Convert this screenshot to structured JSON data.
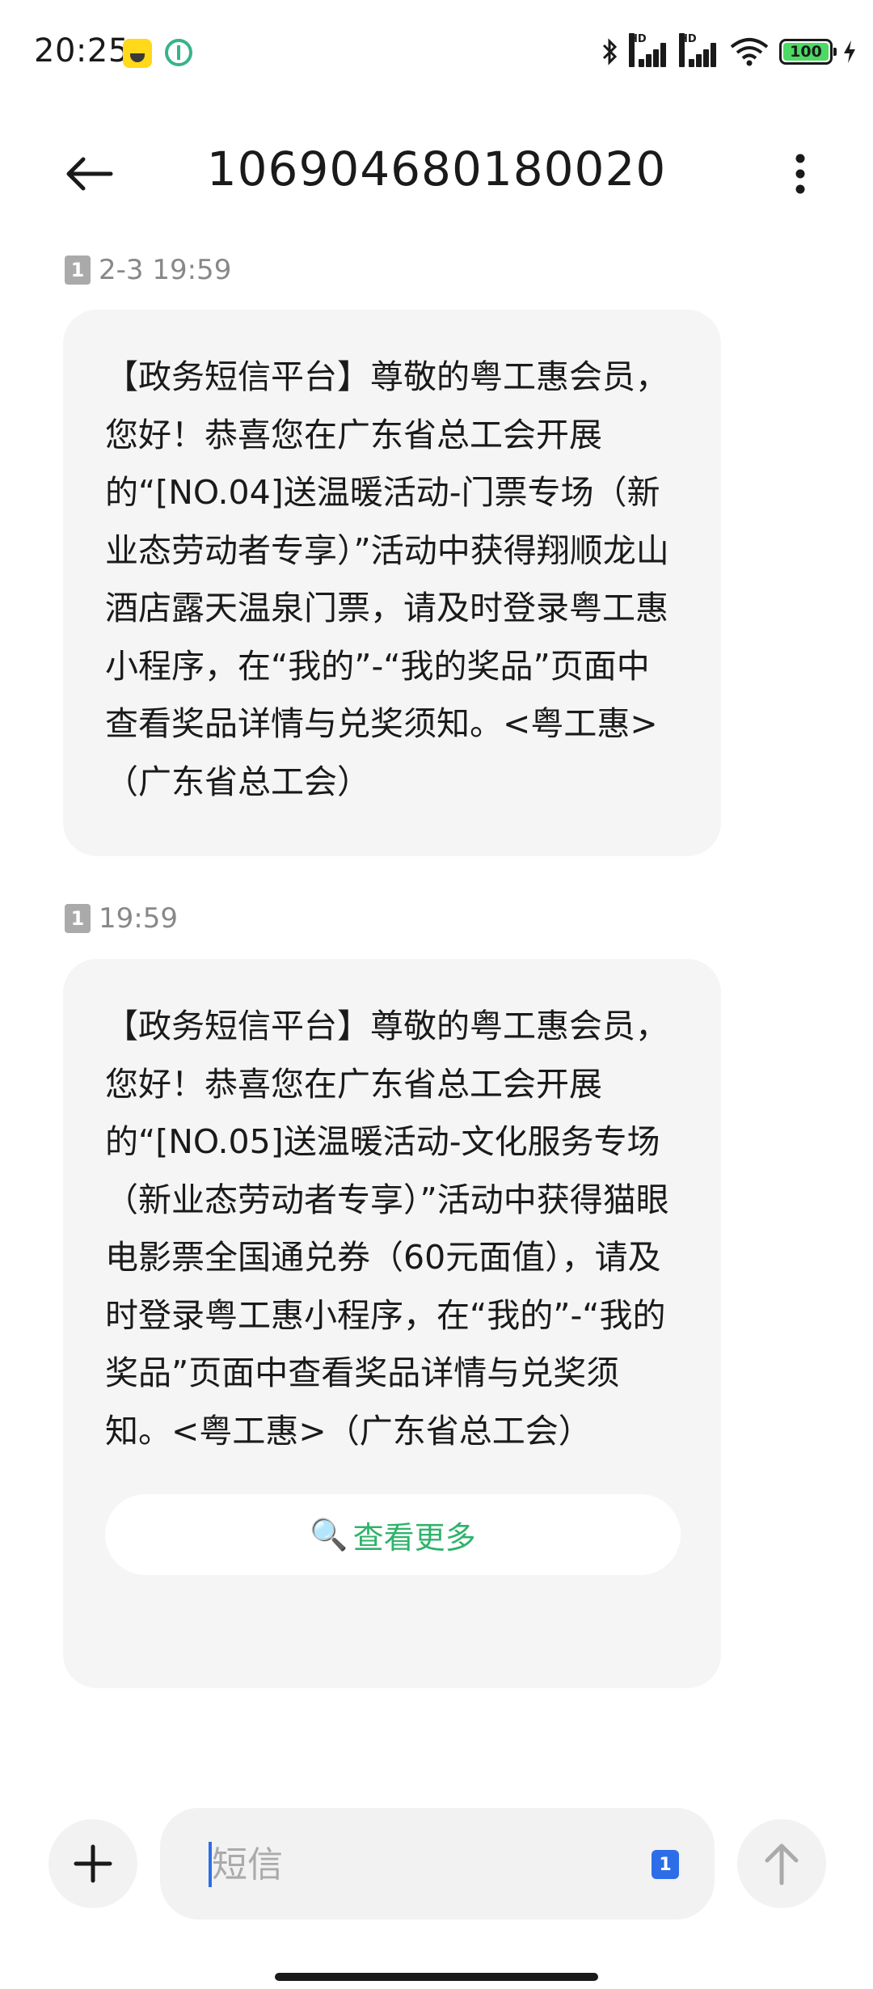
{
  "status_bar": {
    "time": "20:25",
    "battery_text": "100"
  },
  "header": {
    "title": "106904680180020"
  },
  "messages": [
    {
      "sim": "1",
      "time": "2-3 19:59",
      "text": "【政务短信平台】尊敬的粤工惠会员，您好！恭喜您在广东省总工会开展的“[NO.04]送温暖活动-门票专场（新业态劳动者专享）”活动中获得翔顺龙山酒店露天温泉门票，请及时登录粤工惠小程序，在“我的”-“我的奖品”页面中查看奖品详情与兑奖须知。<粤工惠>（广东省总工会）"
    },
    {
      "sim": "1",
      "time": "19:59",
      "text": "【政务短信平台】尊敬的粤工惠会员，您好！恭喜您在广东省总工会开展的“[NO.05]送温暖活动-文化服务专场（新业态劳动者专享）”活动中获得猫眼电影票全国通兑券（60元面值），请及时登录粤工惠小程序，在“我的”-“我的奖品”页面中查看奖品详情与兑奖须知。<粤工惠>（广东省总工会）",
      "view_more_icon": "🔍",
      "view_more_label": "查看更多"
    }
  ],
  "input_bar": {
    "placeholder": "短信",
    "sim_label": "1"
  },
  "colors": {
    "bubble": "#f5f5f5",
    "accent_green": "#2fb36b",
    "accent_blue": "#2d6ee8",
    "meta_gray": "#888888"
  }
}
